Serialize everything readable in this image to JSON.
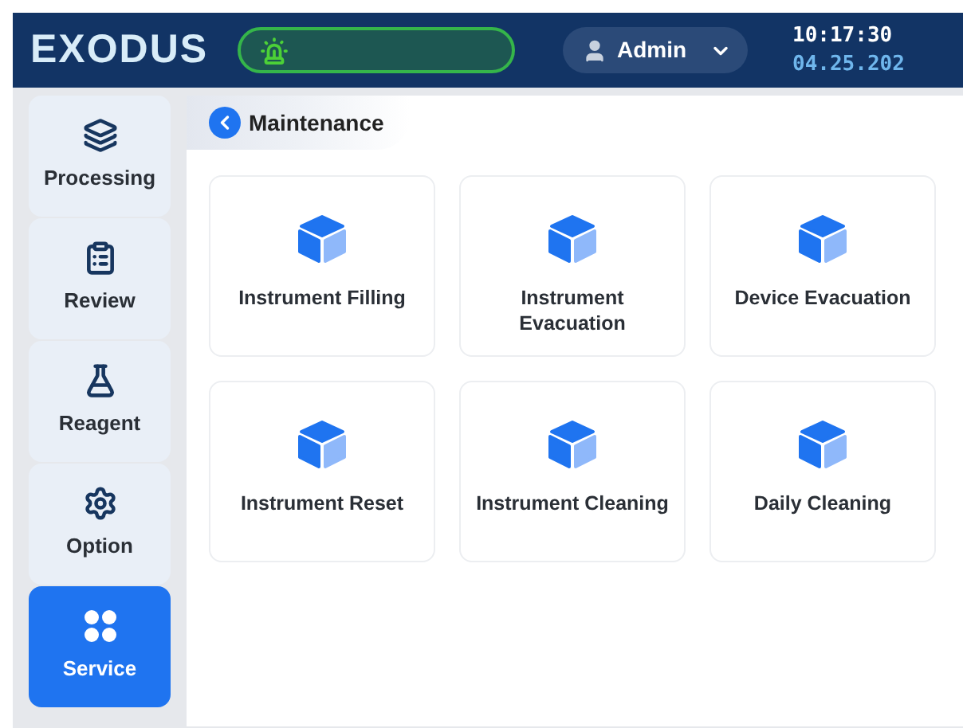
{
  "header": {
    "logo": "EXODUS",
    "user": "Admin",
    "time": "10:17:30",
    "date": "04.25.202"
  },
  "sidebar": {
    "items": [
      {
        "label": "Processing",
        "selected": false
      },
      {
        "label": "Review",
        "selected": false
      },
      {
        "label": "Reagent",
        "selected": false
      },
      {
        "label": "Option",
        "selected": false
      },
      {
        "label": "Service",
        "selected": true
      }
    ]
  },
  "page": {
    "title": "Maintenance"
  },
  "cards": [
    {
      "label": "Instrument Filling"
    },
    {
      "label": "Instrument Evacuation"
    },
    {
      "label": "Device Evacuation"
    },
    {
      "label": "Instrument Reset"
    },
    {
      "label": "Instrument Cleaning"
    },
    {
      "label": "Daily Cleaning"
    }
  ]
}
